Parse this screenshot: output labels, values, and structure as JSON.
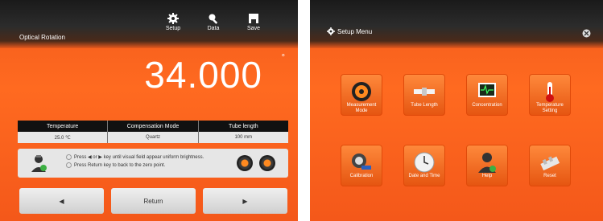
{
  "left_screen": {
    "title": "Optical Rotation",
    "toolbar": [
      {
        "label": "Setup",
        "icon": "gear-icon"
      },
      {
        "label": "Data",
        "icon": "magnifier-icon"
      },
      {
        "label": "Save",
        "icon": "save-icon"
      }
    ],
    "reading": "34.000",
    "unit": "°",
    "table": {
      "headers": [
        "Temperature",
        "Compensation Mode",
        "Tube length"
      ],
      "values": [
        "25.0 ℃",
        "Quartz",
        "100 mm"
      ]
    },
    "instructions": [
      "Press ◀ or ▶ key until visual field appear uniform brightness.",
      "Press Return key to back to the zero point."
    ],
    "buttons": {
      "left": "◀",
      "return": "Return",
      "right": "▶"
    }
  },
  "right_screen": {
    "title": "Setup Menu",
    "tiles": [
      {
        "label": "Measurement Mode",
        "icon": "measurement-icon"
      },
      {
        "label": "Tube Length",
        "icon": "tube-icon"
      },
      {
        "label": "Concentration",
        "icon": "monitor-icon"
      },
      {
        "label": "Temperature Setting",
        "icon": "thermometer-icon"
      },
      {
        "label": "Calibration",
        "icon": "calibration-icon"
      },
      {
        "label": "Date and Time",
        "icon": "clock-icon"
      },
      {
        "label": "Help",
        "icon": "help-person-icon"
      },
      {
        "label": "Reset",
        "icon": "reset-icon"
      }
    ]
  }
}
